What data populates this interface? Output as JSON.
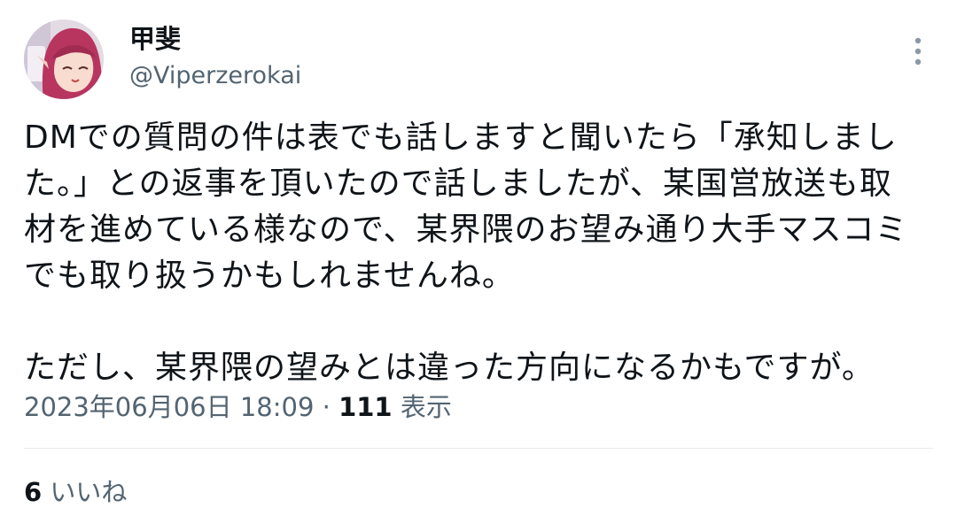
{
  "author": {
    "display_name": "甲斐",
    "handle": "@Viperzerokai"
  },
  "tweet": {
    "text": "DMでの質問の件は表でも話しますと聞いたら「承知しまし\nた。」との返事を頂いたので話しましたが、某国営放送も取\n材を進めている様なので、某界隈のお望み通り大手マスコミ\nでも取り扱うかもしれませんね。\n\nただし、某界隈の望みとは違った方向になるかもですが。",
    "timestamp": "2023年06月06日 18:09",
    "separator": " · ",
    "views_count": "111",
    "views_label": " 表示"
  },
  "engagement": {
    "likes_count": "6",
    "likes_label": " いいね"
  },
  "icons": {
    "more": "more-vertical-icon"
  },
  "colors": {
    "text_primary": "#0f1419",
    "text_secondary": "#536471",
    "divider": "#e6ecf0",
    "avatar_hair": "#b8355f"
  }
}
